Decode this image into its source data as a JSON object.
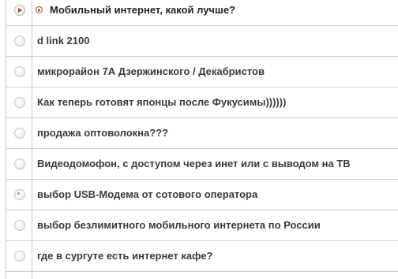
{
  "topics": [
    {
      "title": "Мобильный интернет, какой лучше?",
      "state": "active",
      "marker": true
    },
    {
      "title": "d link 2100",
      "state": "normal",
      "marker": false
    },
    {
      "title": "микрорайон 7А Дзержинского / Декабристов",
      "state": "normal",
      "marker": false
    },
    {
      "title": "Как теперь готовят японцы после Фукусимы))))))",
      "state": "normal",
      "marker": false
    },
    {
      "title": "продажа оптоволокна???",
      "state": "normal",
      "marker": false
    },
    {
      "title": "Видеодомофон, с доступом через инет или с выводом на ТВ",
      "state": "normal",
      "marker": false
    },
    {
      "title": "выбор USB-Модема от сотового оператора",
      "state": "dot",
      "marker": false
    },
    {
      "title": "выбор безлимитного мобильного интернета по России",
      "state": "normal",
      "marker": false
    },
    {
      "title": "где в сургуте есть интернет кафе?",
      "state": "normal",
      "marker": false
    }
  ],
  "colors": {
    "border": "#cfcfcf",
    "text": "#3a3a3a",
    "marker": "#c0392b"
  }
}
